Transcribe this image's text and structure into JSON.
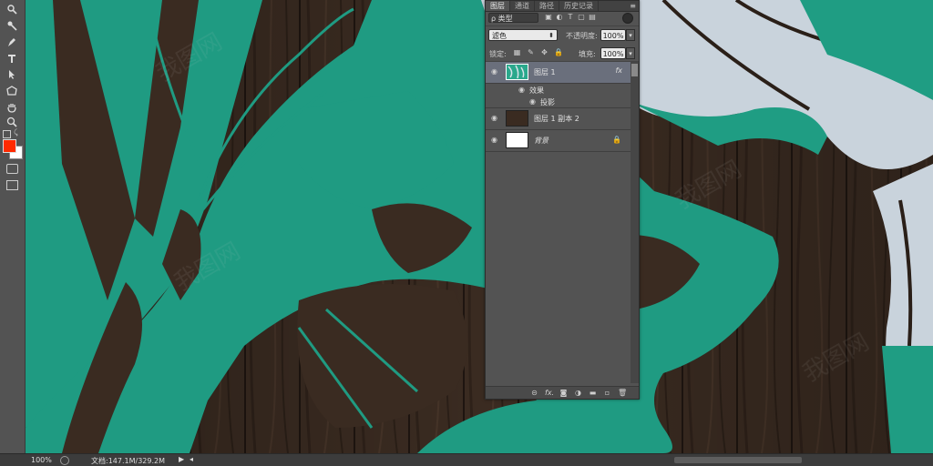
{
  "toolbar": {
    "tools": [
      "zoom-ish-icon",
      "quick-select-icon",
      "pen-icon",
      "type-icon",
      "path-select-icon",
      "shape-icon",
      "hand-icon",
      "zoom-icon"
    ],
    "fg_color": "#ff2a00",
    "bg_color": "#ffffff"
  },
  "status": {
    "zoom": "100%",
    "doc": "文档:147.1M/329.2M"
  },
  "panel": {
    "tabs": [
      "图层",
      "通道",
      "路径",
      "历史记录"
    ],
    "active_tab": "图层",
    "menu_icon": "≡",
    "filter_label": "ρ 类型",
    "blend_mode": "滤色",
    "opacity_label": "不透明度:",
    "opacity_value": "100%",
    "lock_label": "锁定:",
    "fill_label": "填充:",
    "fill_value": "100%",
    "layers": [
      {
        "name": "图层 1",
        "fx": "fx",
        "selected": true
      },
      {
        "name": "图层 1 副本 2"
      },
      {
        "name": "背景"
      }
    ],
    "effects_label": "效果",
    "effect_item": "投影",
    "bottom_icons": [
      "link-icon",
      "fx-icon",
      "mask-icon",
      "adjustment-icon",
      "group-icon",
      "new-layer-icon",
      "trash-icon"
    ],
    "bottom_fx": "fx."
  },
  "colors": {
    "wood": "#3a2c22",
    "teal": "#1f9d83",
    "white_fill": "#c8d2dc"
  }
}
